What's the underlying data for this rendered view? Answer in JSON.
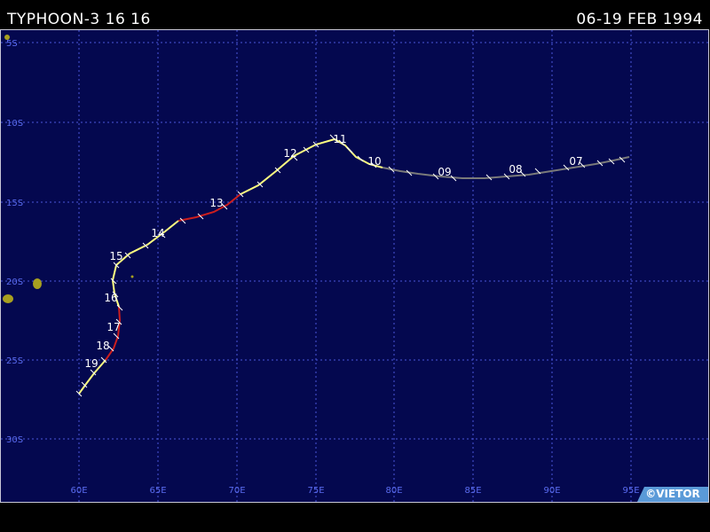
{
  "header": {
    "storm_name": "TYPHOON-3 16 16",
    "date_range": "06-19 FEB 1994"
  },
  "map": {
    "background_color": "#04084f",
    "grid_color": "#4a56d8",
    "label_color": "#5a6cf0",
    "lon_labels": [
      "60E",
      "65E",
      "70E",
      "75E",
      "80E",
      "85E",
      "90E",
      "95E"
    ],
    "lat_labels": [
      "5S",
      "10S",
      "15S",
      "20S",
      "25S",
      "30S"
    ],
    "land_color": "#a8a020"
  },
  "track": {
    "colors": {
      "depression": "#7a7a7a",
      "storm": "#ffff80",
      "typhoon": "#cc1e1e"
    },
    "day_labels": [
      "07",
      "08",
      "09",
      "10",
      "11",
      "12",
      "13",
      "14",
      "15",
      "16",
      "17",
      "18",
      "19"
    ]
  },
  "footer": {
    "copyright": "©VIETOR"
  }
}
